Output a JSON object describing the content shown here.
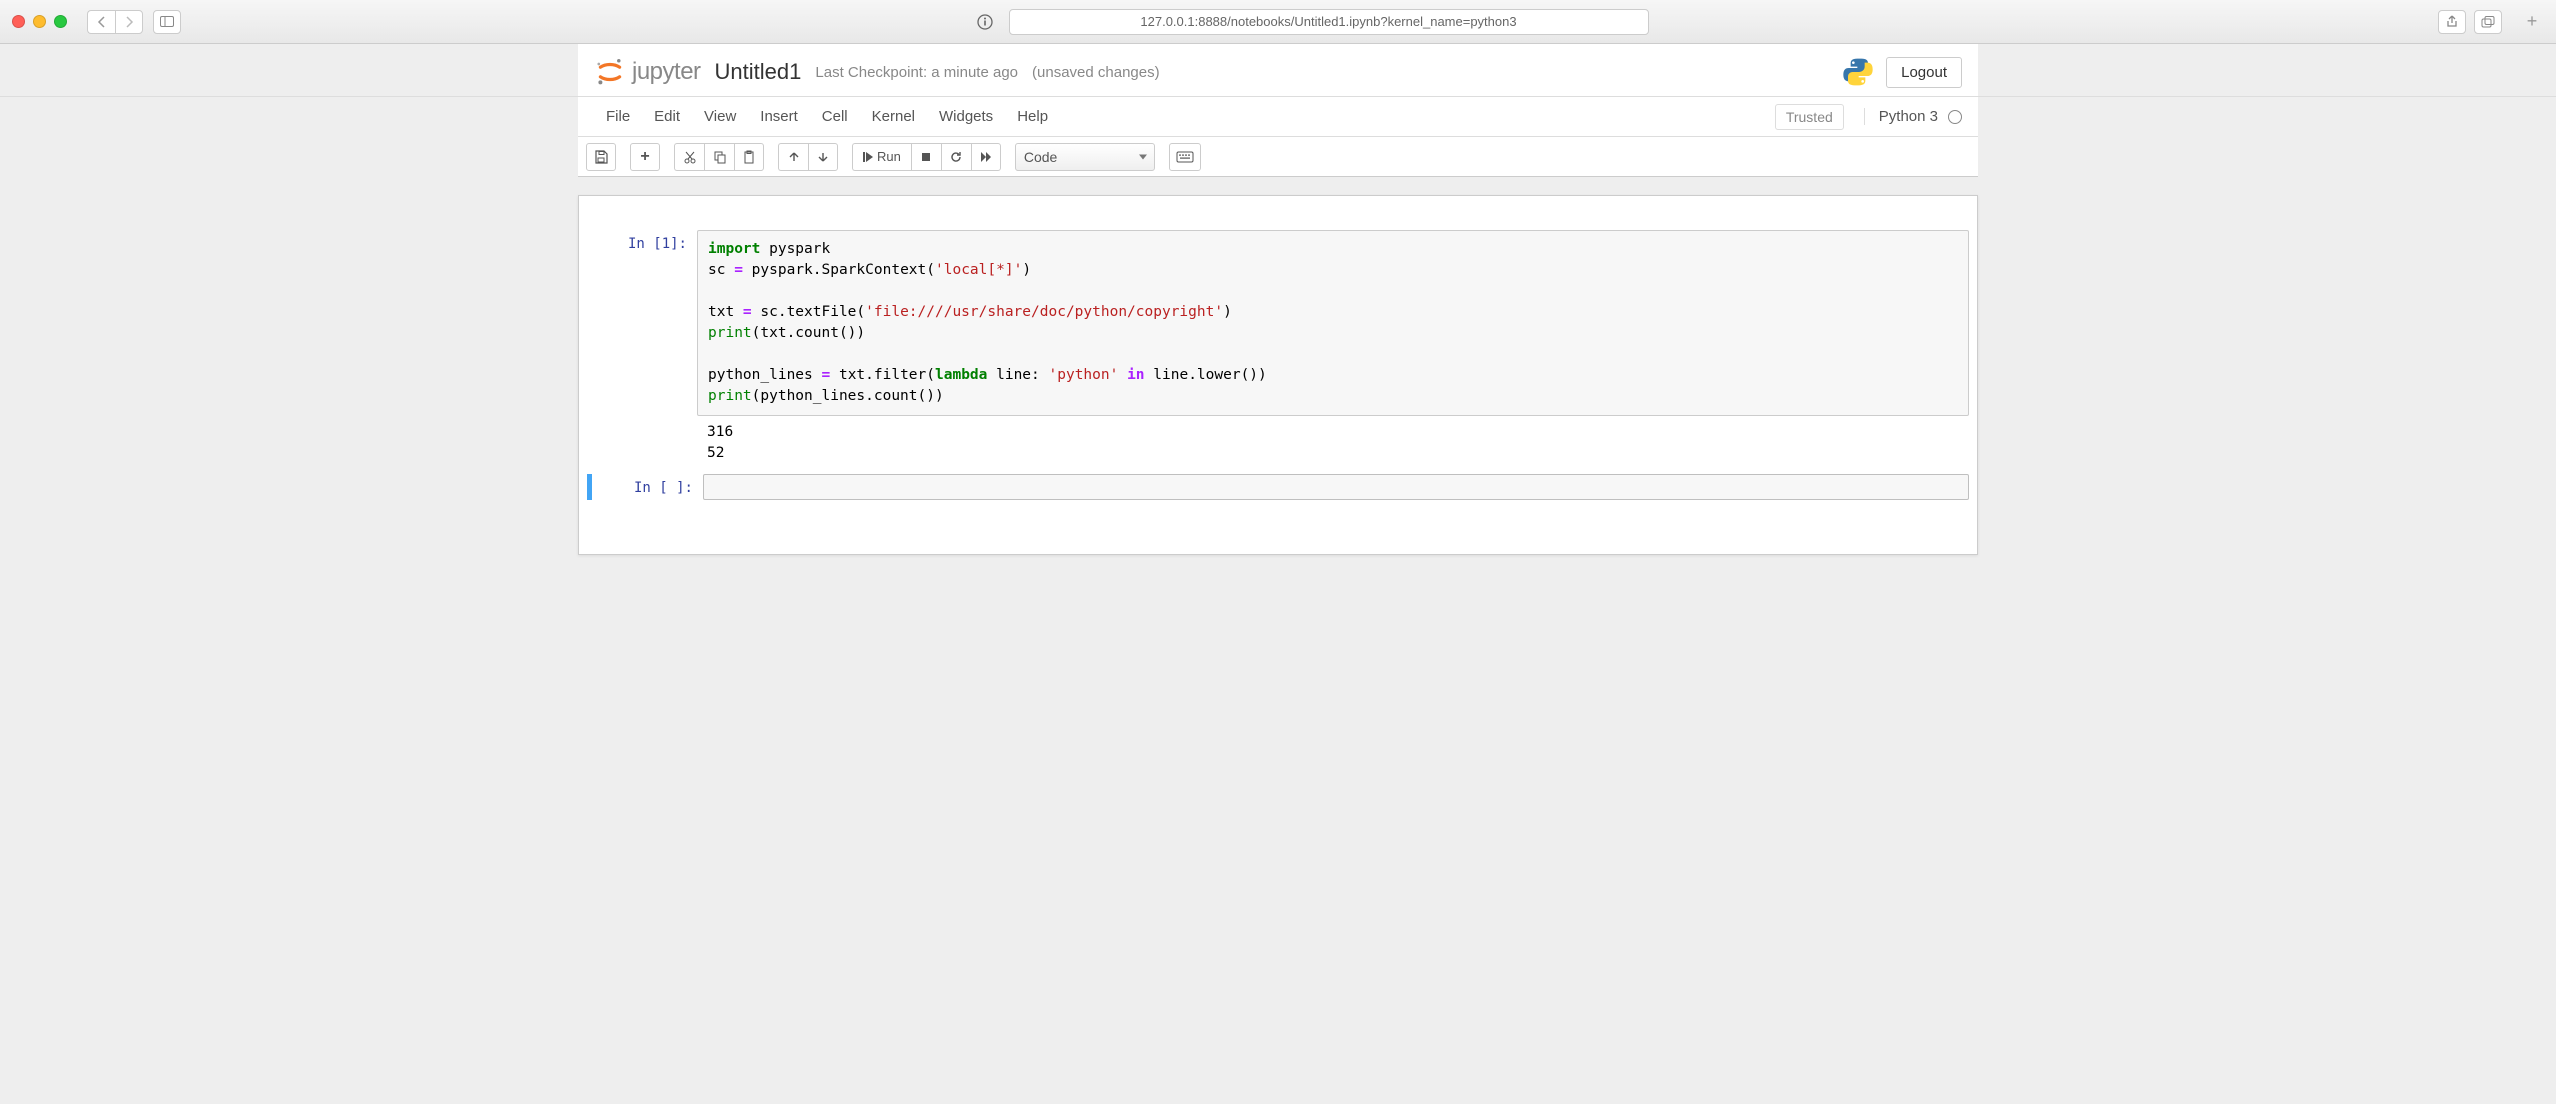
{
  "browser": {
    "url": "127.0.0.1:8888/notebooks/Untitled1.ipynb?kernel_name=python3"
  },
  "header": {
    "logo_text": "jupyter",
    "title": "Untitled1",
    "checkpoint": "Last Checkpoint: a minute ago",
    "unsaved": "(unsaved changes)",
    "logout": "Logout"
  },
  "menu": {
    "file": "File",
    "edit": "Edit",
    "view": "View",
    "insert": "Insert",
    "cell": "Cell",
    "kernel": "Kernel",
    "widgets": "Widgets",
    "help": "Help",
    "trusted": "Trusted",
    "kernel_name": "Python 3"
  },
  "toolbar": {
    "run_label": "Run",
    "cell_type": "Code"
  },
  "cells": {
    "c1": {
      "prompt": "In [1]:",
      "code": {
        "l1_kw": "import",
        "l1_mod": " pyspark",
        "l2_a": "sc ",
        "l2_op": "=",
        "l2_b": " pyspark.SparkContext(",
        "l2_str": "'local[*]'",
        "l2_c": ")",
        "l3_a": "txt ",
        "l3_op": "=",
        "l3_b": " sc.textFile(",
        "l3_str": "'file:////usr/share/doc/python/copyright'",
        "l3_c": ")",
        "l4_a": "print",
        "l4_b": "(txt.count())",
        "l5_a": "python_lines ",
        "l5_op": "=",
        "l5_b": " txt.filter(",
        "l5_lam": "lambda",
        "l5_c": " line: ",
        "l5_str": "'python'",
        "l5_d": " ",
        "l5_in": "in",
        "l5_e": " line.lower())",
        "l6_a": "print",
        "l6_b": "(python_lines.count())"
      },
      "output": "316\n52"
    },
    "c2": {
      "prompt": "In [ ]:"
    }
  }
}
